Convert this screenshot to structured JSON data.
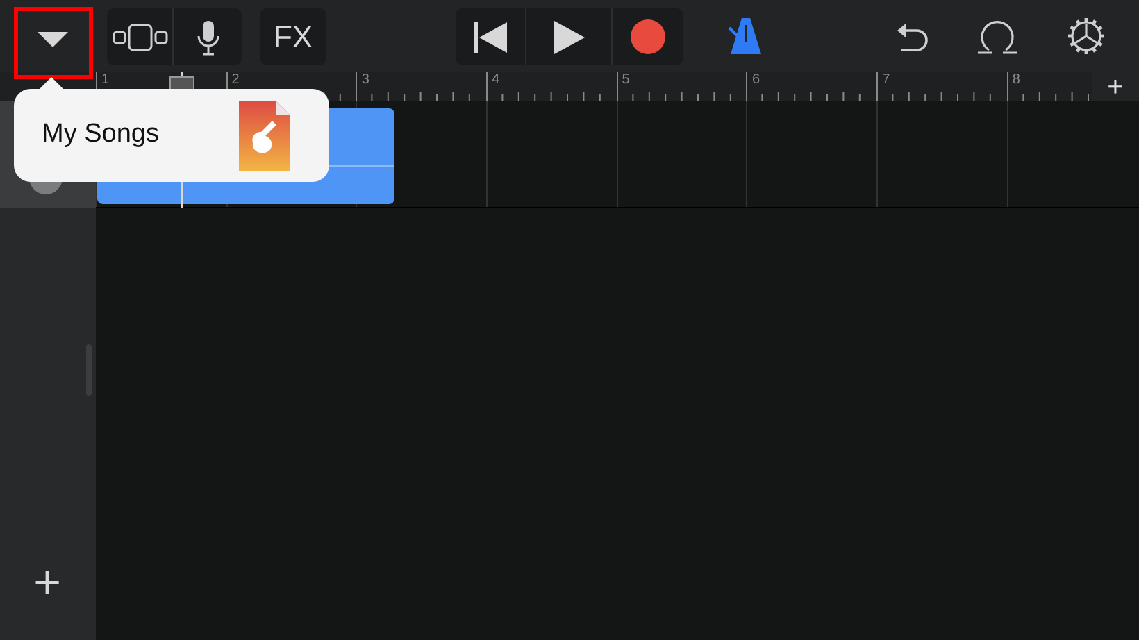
{
  "toolbar": {
    "browser_button": {
      "highlighted": true
    },
    "fx_label": "FX",
    "metronome": {
      "on": true
    }
  },
  "ruler": {
    "bars": [
      "1",
      "2",
      "3",
      "4",
      "5",
      "6",
      "7",
      "8"
    ],
    "add_label": "+"
  },
  "track": {
    "region": {
      "kind": "audio"
    }
  },
  "popover": {
    "label": "My Songs"
  },
  "add_track_label": "+"
}
